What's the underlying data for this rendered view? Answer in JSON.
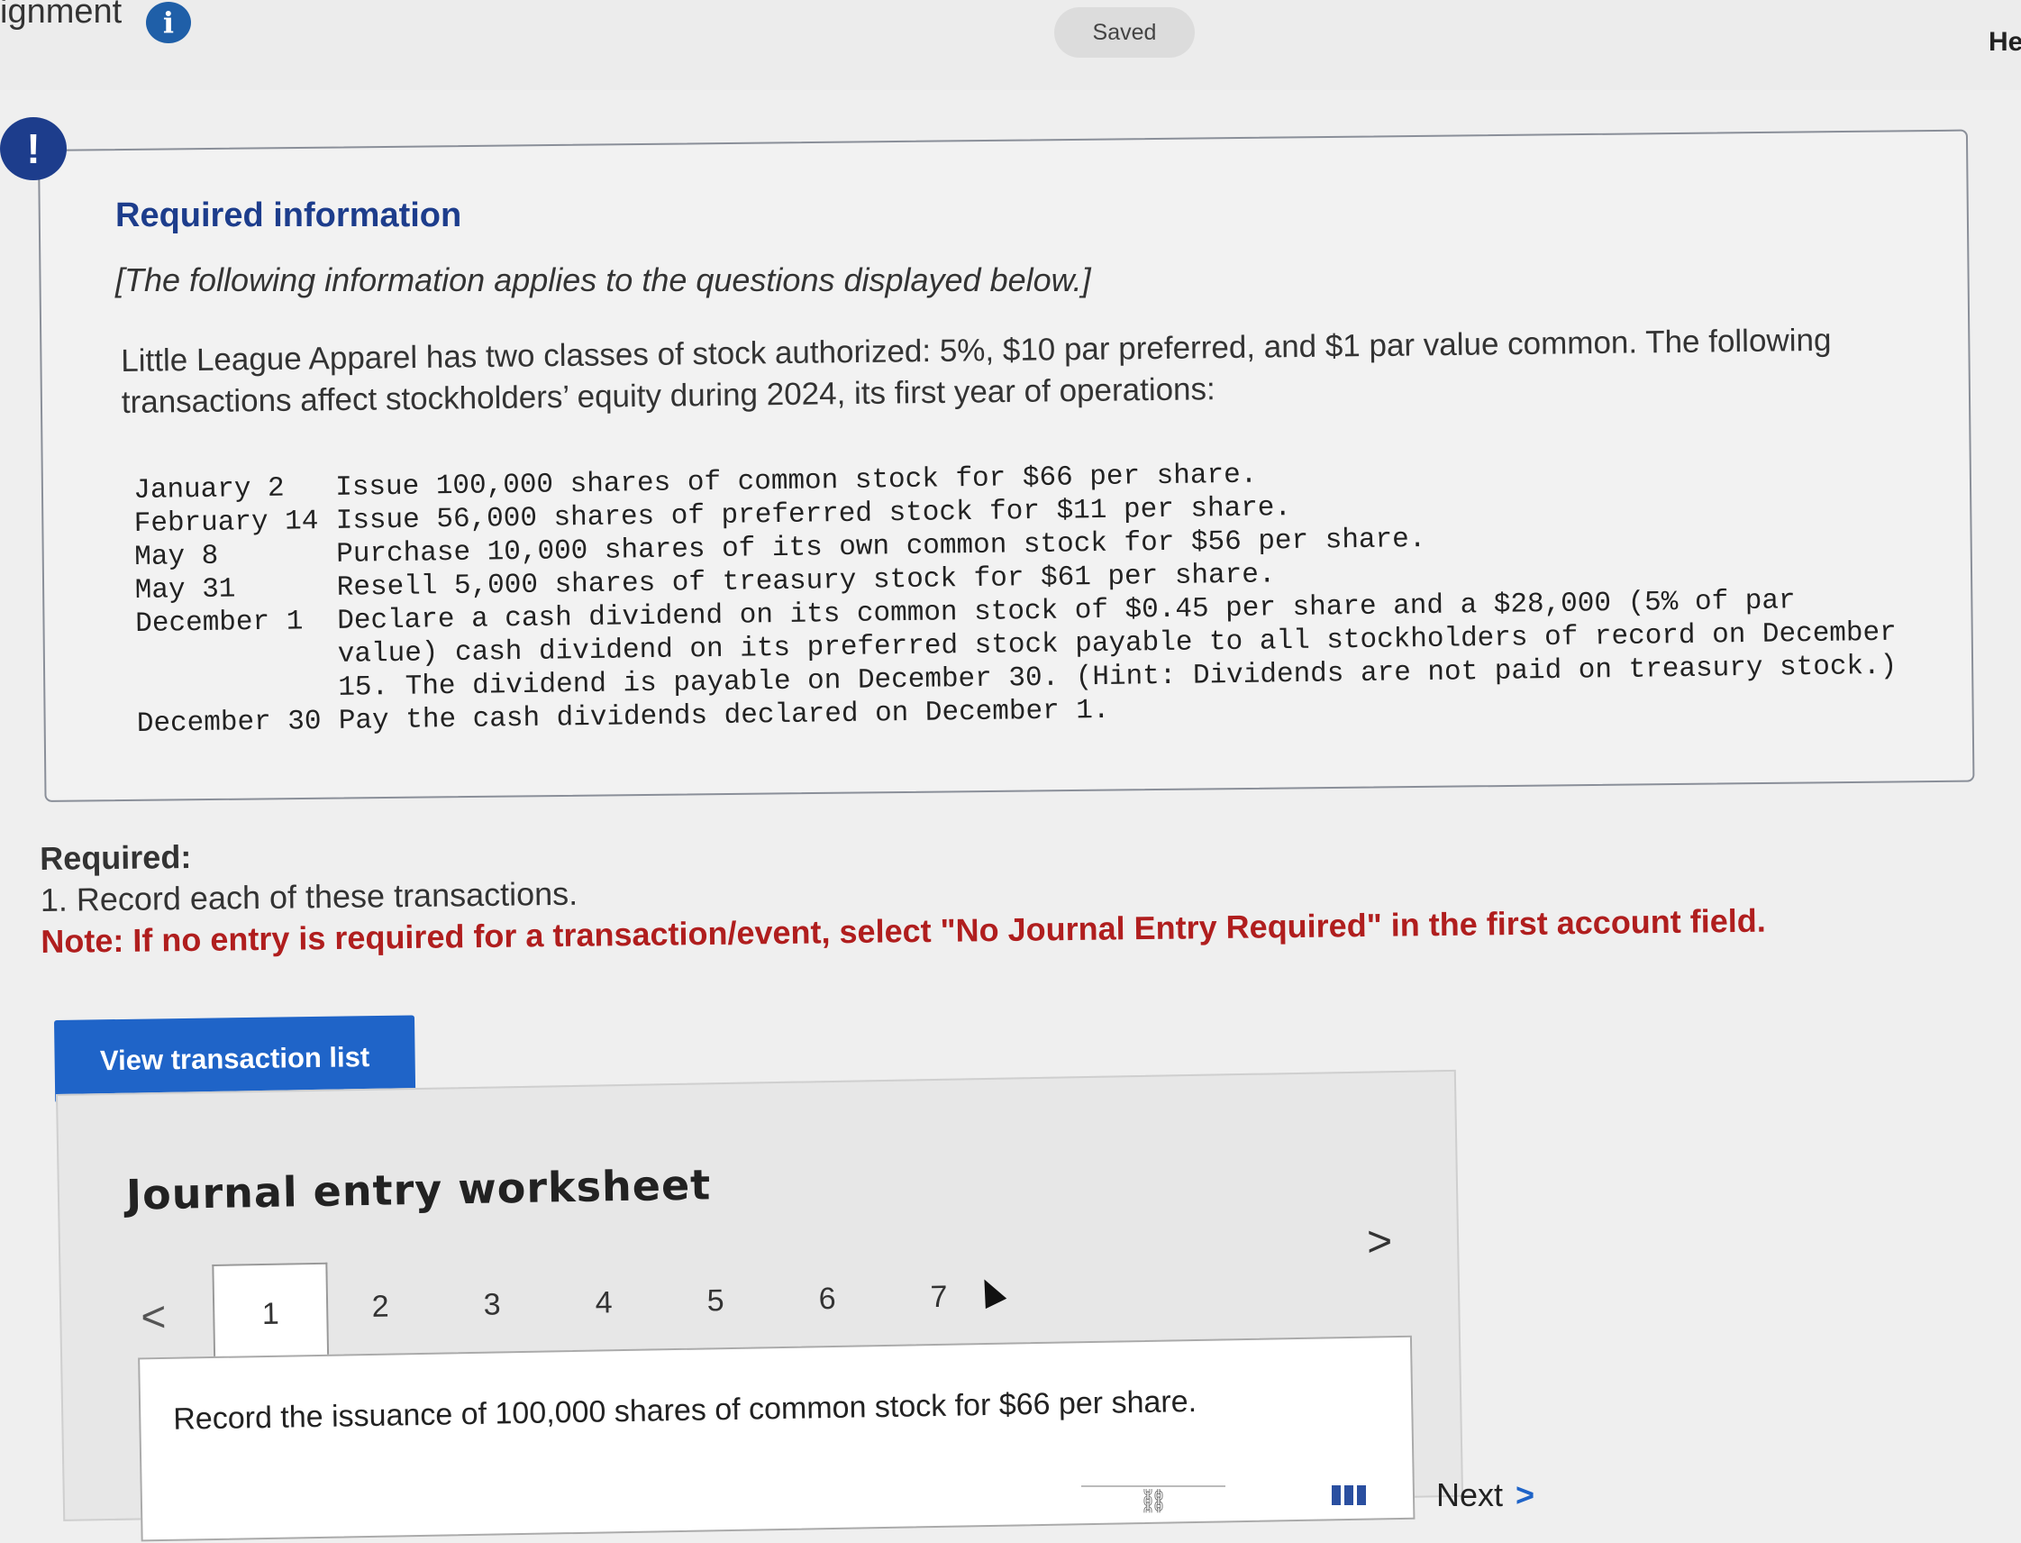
{
  "header": {
    "assignment_title": "ignment",
    "info_icon_glyph": "i",
    "saved_label": "Saved",
    "help_label": "He"
  },
  "alert_icon_glyph": "!",
  "required_info": {
    "heading": "Required information",
    "applies_note": "[The following information applies to the questions displayed below.]",
    "intro": "Little League Apparel has two classes of stock authorized: 5%, $10 par preferred, and $1 par value common. The following transactions affect stockholders’ equity during 2024, its first year of operations:",
    "transactions": [
      {
        "date": "January 2",
        "description": "Issue 100,000 shares of common stock for $66 per share."
      },
      {
        "date": "February 14",
        "description": "Issue 56,000 shares of preferred stock for $11 per share."
      },
      {
        "date": "May 8",
        "description": "Purchase 10,000 shares of its own common stock for $56 per share."
      },
      {
        "date": "May 31",
        "description": "Resell 5,000 shares of treasury stock for $61 per share."
      },
      {
        "date": "December 1",
        "description": "Declare a cash dividend on its common stock of $0.45 per share and a $28,000 (5% of par value) cash dividend on its preferred stock payable to all stockholders of record on December 15. The dividend is payable on December 30. (Hint: Dividends are not paid on treasury stock.)"
      },
      {
        "date": "December 30",
        "description": "Pay the cash dividends declared on December 1."
      }
    ]
  },
  "required": {
    "label": "Required:",
    "step": "1. Record each of these transactions.",
    "note": "Note: If no entry is required for a transaction/event, select \"No Journal Entry Required\" in the first account field."
  },
  "view_transaction_button": "View transaction list",
  "worksheet": {
    "title": "Journal entry worksheet",
    "prev_glyph": "<",
    "next_glyph": ">",
    "tabs": [
      "1",
      "2",
      "3",
      "4",
      "5",
      "6",
      "7"
    ],
    "active_tab": "1",
    "instruction": "Record the issuance of 100,000 shares of common stock for $66 per share."
  },
  "footer": {
    "link_glyph": "⛓",
    "next_label": "Next",
    "next_glyph": ">"
  }
}
